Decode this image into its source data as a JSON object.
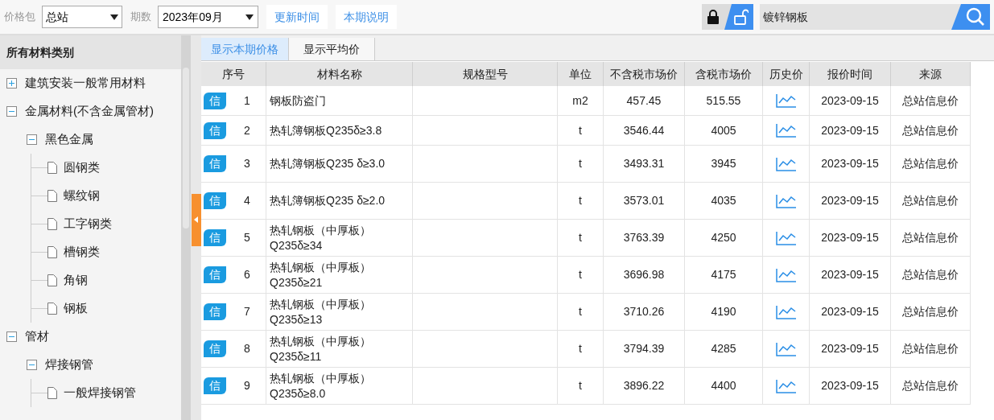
{
  "toolbar": {
    "package_label": "价格包",
    "package_value": "总站",
    "period_label": "期数",
    "period_value": "2023年09月",
    "buttons": [
      "更新时间",
      "本期说明"
    ],
    "lock_buttons": [
      {
        "kind": "lock",
        "selected": false
      },
      {
        "kind": "unlock",
        "selected": true
      }
    ],
    "search_value": "镀锌钢板"
  },
  "sidebar": {
    "title": "所有材料类别",
    "tree": [
      {
        "label": "建筑安装一般常用材料",
        "expanded": false
      },
      {
        "label": "金属材料(不含金属管材)",
        "expanded": true,
        "children": [
          {
            "label": "黑色金属",
            "expanded": true,
            "children": [
              {
                "label": "圆钢类"
              },
              {
                "label": "螺纹钢"
              },
              {
                "label": "工字钢类"
              },
              {
                "label": "槽钢类"
              },
              {
                "label": "角钢"
              },
              {
                "label": "钢板"
              }
            ]
          }
        ]
      },
      {
        "label": "管材",
        "expanded": true,
        "children": [
          {
            "label": "焊接钢管",
            "expanded": true,
            "children": [
              {
                "label": "一般焊接钢管"
              }
            ]
          }
        ]
      }
    ]
  },
  "tabs": [
    {
      "label": "显示本期价格",
      "selected": true
    },
    {
      "label": "显示平均价",
      "selected": false
    }
  ],
  "table": {
    "columns": [
      "序号",
      "材料名称",
      "规格型号",
      "单位",
      "不含税市场价",
      "含税市场价",
      "历史价",
      "报价时间",
      "来源"
    ],
    "rows": [
      {
        "badge": "信",
        "no": "1",
        "name": "钢板防盗门",
        "spec": "",
        "unit": "m2",
        "price": "457.45",
        "tax_price": "515.55",
        "date": "2023-09-15",
        "source": "总站信息价"
      },
      {
        "badge": "信",
        "no": "2",
        "name": "热轧簿钢板Q235δ≥3.8",
        "spec": "",
        "unit": "t",
        "price": "3546.44",
        "tax_price": "4005",
        "date": "2023-09-15",
        "source": "总站信息价"
      },
      {
        "badge": "信",
        "no": "3",
        "name": "热轧簿钢板Q235 δ≥3.0",
        "spec": "",
        "unit": "t",
        "price": "3493.31",
        "tax_price": "3945",
        "date": "2023-09-15",
        "source": "总站信息价"
      },
      {
        "badge": "信",
        "no": "4",
        "name": "热轧簿钢板Q235 δ≥2.0",
        "spec": "",
        "unit": "t",
        "price": "3573.01",
        "tax_price": "4035",
        "date": "2023-09-15",
        "source": "总站信息价"
      },
      {
        "badge": "信",
        "no": "5",
        "name": "热轧钢板（中厚板）Q235δ≥34",
        "spec": "",
        "unit": "t",
        "price": "3763.39",
        "tax_price": "4250",
        "date": "2023-09-15",
        "source": "总站信息价"
      },
      {
        "badge": "信",
        "no": "6",
        "name": "热轧钢板（中厚板）Q235δ≥21",
        "spec": "",
        "unit": "t",
        "price": "3696.98",
        "tax_price": "4175",
        "date": "2023-09-15",
        "source": "总站信息价"
      },
      {
        "badge": "信",
        "no": "7",
        "name": "热轧钢板（中厚板）Q235δ≥13",
        "spec": "",
        "unit": "t",
        "price": "3710.26",
        "tax_price": "4190",
        "date": "2023-09-15",
        "source": "总站信息价"
      },
      {
        "badge": "信",
        "no": "8",
        "name": "热轧钢板（中厚板）Q235δ≥11",
        "spec": "",
        "unit": "t",
        "price": "3794.39",
        "tax_price": "4285",
        "date": "2023-09-15",
        "source": "总站信息价"
      },
      {
        "badge": "信",
        "no": "9",
        "name": "热轧钢板（中厚板）Q235δ≥8.0",
        "spec": "",
        "unit": "t",
        "price": "3896.22",
        "tax_price": "4400",
        "date": "2023-09-15",
        "source": "总站信息价"
      }
    ]
  }
}
